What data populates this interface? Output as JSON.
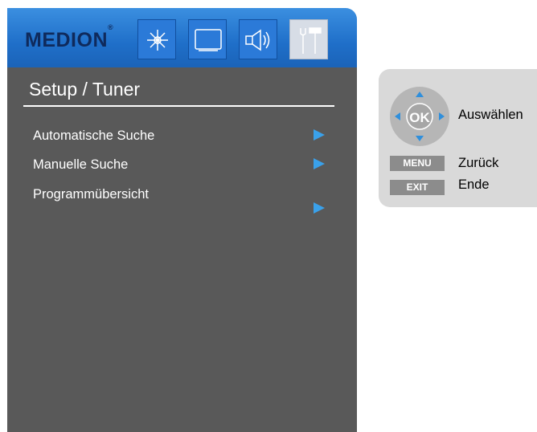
{
  "brand": {
    "logo_text": "MEDION",
    "registered": "®"
  },
  "tabs": [
    {
      "icon": "picture-brightness-icon",
      "active": false
    },
    {
      "icon": "tv-screen-icon",
      "active": false
    },
    {
      "icon": "speaker-audio-icon",
      "active": false
    },
    {
      "icon": "tools-setup-icon",
      "active": true
    }
  ],
  "menu": {
    "title": "Setup / Tuner",
    "items": [
      {
        "label": "Automatische Suche"
      },
      {
        "label": "Manuelle Suche"
      },
      {
        "label": "Programmübersicht"
      }
    ]
  },
  "help": {
    "ok_key": "OK",
    "ok_action": "Auswählen",
    "menu_key": "MENU",
    "menu_action": "Zurück",
    "exit_key": "EXIT",
    "exit_action": "Ende"
  },
  "colors": {
    "header_blue": "#1f6fc9",
    "panel_gray": "#595959",
    "arrow_blue": "#3aa1ea",
    "help_bg": "#d9d9d9"
  }
}
